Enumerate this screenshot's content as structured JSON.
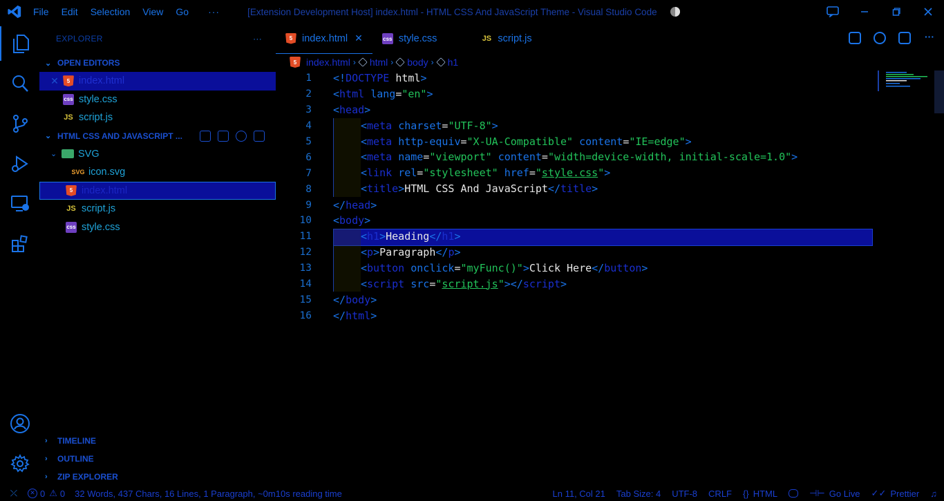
{
  "titlebar": {
    "menu": [
      "File",
      "Edit",
      "Selection",
      "View",
      "Go"
    ],
    "more": "···",
    "title": "[Extension Development Host] index.html - HTML CSS And JavaScript Theme - Visual Studio Code"
  },
  "sidebar": {
    "header": "EXPLORER",
    "more": "···",
    "open_editors": {
      "title": "OPEN EDITORS",
      "items": [
        {
          "name": "index.html",
          "type": "html",
          "close": "✕"
        },
        {
          "name": "style.css",
          "type": "css"
        },
        {
          "name": "script.js",
          "type": "js"
        }
      ]
    },
    "workspace": {
      "title": "HTML CSS AND JAVASCRIPT ...",
      "folder": "SVG",
      "folder_items": [
        {
          "name": "icon.svg",
          "type": "svg"
        }
      ],
      "files": [
        {
          "name": "index.html",
          "type": "html"
        },
        {
          "name": "script.js",
          "type": "js"
        },
        {
          "name": "style.css",
          "type": "css"
        }
      ]
    },
    "bottom_sections": [
      "TIMELINE",
      "OUTLINE",
      "ZIP EXPLORER"
    ]
  },
  "tabs": [
    {
      "name": "index.html",
      "type": "html",
      "active": true,
      "close": "✕"
    },
    {
      "name": "style.css",
      "type": "css"
    },
    {
      "name": "script.js",
      "type": "js"
    }
  ],
  "breadcrumb": [
    "index.html",
    "html",
    "body",
    "h1"
  ],
  "icon_labels": {
    "css": "css",
    "js": "JS",
    "svg": "SVG",
    "html": "5"
  },
  "code": {
    "current_line": 11,
    "line_numbers": [
      "1",
      "2",
      "3",
      "4",
      "5",
      "6",
      "7",
      "8",
      "9",
      "10",
      "11",
      "12",
      "13",
      "14",
      "15",
      "16"
    ]
  },
  "statusbar": {
    "errors": "0",
    "warnings": "0",
    "stats": "32 Words, 437 Chars, 16 Lines, 1 Paragraph, ~0m10s reading time",
    "position": "Ln 11, Col 21",
    "tab_size": "Tab Size: 4",
    "encoding": "UTF-8",
    "eol": "CRLF",
    "language": "HTML",
    "golive": "Go Live",
    "prettier": "Prettier"
  },
  "colors": {
    "accent": "#1a73e8",
    "tag": "#1a2fd0",
    "string": "#22c35a",
    "text": "#e8e8e8",
    "selection": "#0a0f9a"
  }
}
